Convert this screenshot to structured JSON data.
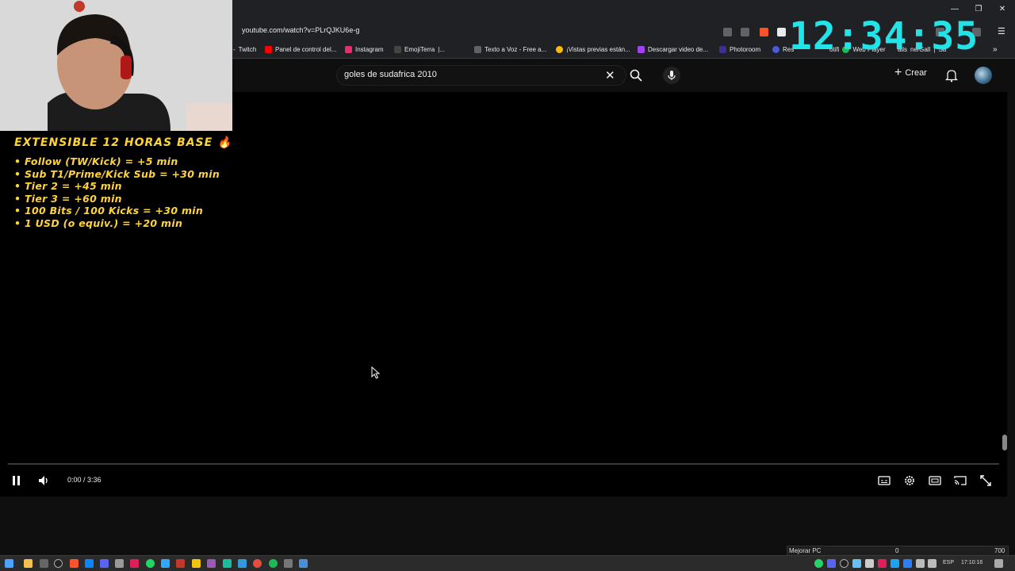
{
  "browser": {
    "url": "youtube.com/watch?v=PLrQJKU6e-g",
    "bookmarks": [
      {
        "label": "Twitch",
        "prefix": "- ",
        "color": "#9146ff"
      },
      {
        "label": "Panel de control del...",
        "color": "#ff0000"
      },
      {
        "label": "Instagram",
        "color": "#e1306c"
      },
      {
        "label": "EmojiTerra",
        "color": "#444444"
      },
      {
        "label": "Texto a Voz - Free a...",
        "color": "#5f6368"
      },
      {
        "label": "¡Vistas previas están...",
        "color": "#fbbc04"
      },
      {
        "label": "Descargar video de...",
        "color": "#a142f4"
      },
      {
        "label": "Photoroom",
        "color": "#3b2f8f"
      },
      {
        "label": "Res",
        "color": "#4a5bd8"
      },
      {
        "label": "otifi",
        "color": "#1db954"
      },
      {
        "label": "Web Player",
        "color": "#1db954"
      },
      {
        "label": "ails",
        "color": "#ffffff"
      },
      {
        "label": "ne/Gall",
        "color": "#ffffff"
      },
      {
        "label": "Sa",
        "color": "#ffffff"
      }
    ]
  },
  "clock": "12:34:35",
  "youtube": {
    "search_value": "goles de sudafrica 2010",
    "create_label": "Crear",
    "time_display": "0:00 / 3:36"
  },
  "overlay": {
    "title": "EXTENSIBLE 12 HORAS BASE 🔥",
    "items": [
      "Follow (TW/Kick) = +5 min",
      "Sub T1/Prime/Kick Sub = +30 min",
      "Tier 2 = +45 min",
      "Tier 3 = +60 min",
      "100 Bits / 100 Kicks = +30 min",
      "1 USD (o equiv.) = +20 min"
    ]
  },
  "perf_widget": {
    "label": "Mejorar PC",
    "value_a": "0",
    "value_b": "700"
  },
  "taskbar": {
    "lang": "ESP",
    "time": "17:10:16"
  },
  "colors": {
    "clock": "#22e3e8",
    "overlay_text": "#ffd43b"
  }
}
